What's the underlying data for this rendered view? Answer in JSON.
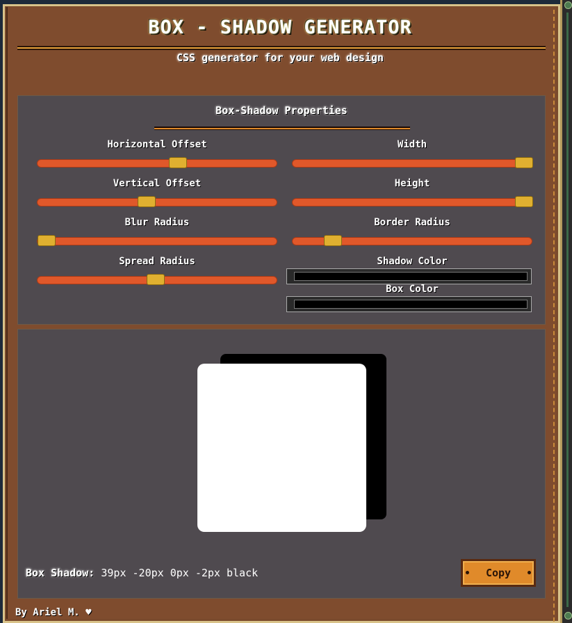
{
  "header": {
    "title": "BOX - SHADOW GENERATOR",
    "subtitle": "CSS generator for your web design"
  },
  "properties": {
    "title": "Box-Shadow Properties",
    "sliders": [
      {
        "label": "Horizontal Offset",
        "level": 0.59
      },
      {
        "label": "Vertical Offset",
        "level": 0.45
      },
      {
        "label": "Blur Radius",
        "level": 0.0
      },
      {
        "label": "Spread Radius",
        "level": 0.49
      },
      {
        "label": "Width",
        "level": 1.0
      },
      {
        "label": "Height",
        "level": 1.0
      },
      {
        "label": "Border Radius",
        "level": 0.14
      }
    ],
    "shadow_color_label": "Shadow Color",
    "shadow_color": "#000000",
    "box_color_label": "Box Color",
    "box_color": "#000000"
  },
  "output": {
    "label": "Box Shadow:",
    "value": "39px -20px 0px -2px black"
  },
  "copy_label": "Copy",
  "footer": {
    "text": "By Ariel M. ♥"
  },
  "colors": {
    "accent": "#e0582a",
    "thumb": "#e0b030",
    "panel": "#4f4a4f",
    "frame": "#7f4c2e"
  }
}
